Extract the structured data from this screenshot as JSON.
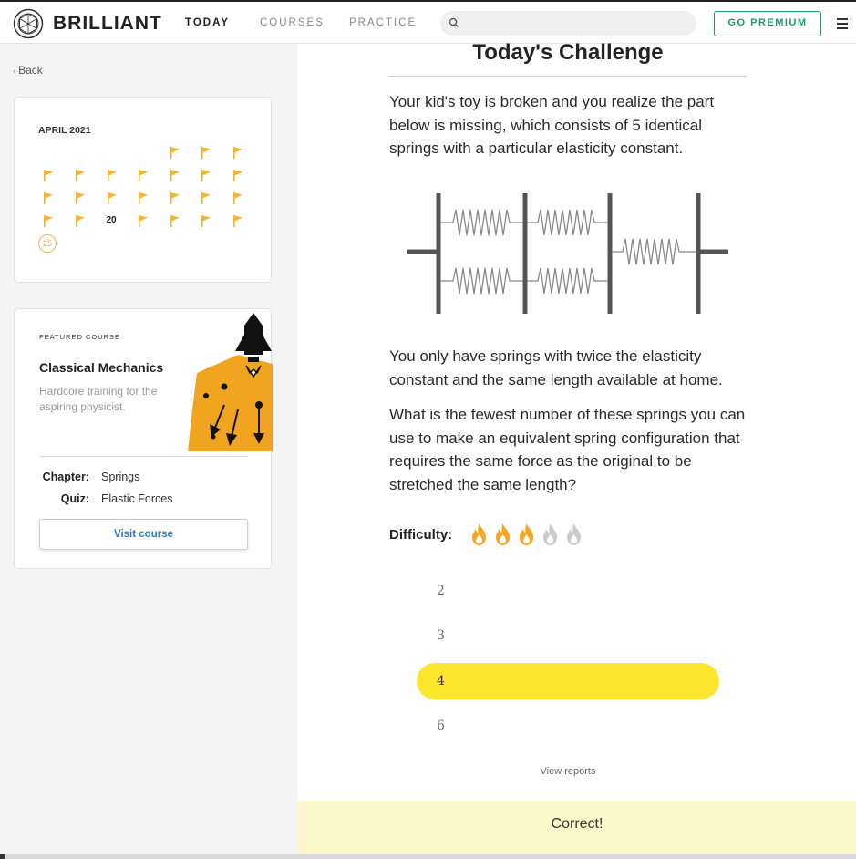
{
  "header": {
    "brand": "BRILLIANT",
    "nav": [
      {
        "label": "TODAY",
        "active": true
      },
      {
        "label": "COURSES",
        "active": false
      },
      {
        "label": "PRACTICE",
        "active": false
      }
    ],
    "search_placeholder": "",
    "premium_label": "GO PREMIUM"
  },
  "sidebar": {
    "back_label": "Back",
    "calendar": {
      "month": "APRIL 2021",
      "day_20": "20",
      "today": "25",
      "flag_color": "#f7b32b"
    },
    "featured": {
      "label": "FEATURED COURSE",
      "title": "Classical Mechanics",
      "description": "Hardcore training for the aspiring physicist.",
      "chapter_label": "Chapter:",
      "chapter_value": "Springs",
      "quiz_label": "Quiz:",
      "quiz_value": "Elastic Forces",
      "visit_label": "Visit course"
    }
  },
  "challenge": {
    "title": "Today's Challenge",
    "para1": "Your kid's toy is broken and you realize the part below is missing, which consists of 5 identical springs with a particular elasticity constant.",
    "para2": "You only have springs with twice the elasticity constant and the same length available at home.",
    "para3": "What is the fewest number of these springs you can use to make an equivalent spring configuration that requires the same force as the original to be stretched the same length?",
    "difficulty_label": "Difficulty:",
    "difficulty_level": 3,
    "difficulty_max": 5,
    "options": [
      {
        "value": "2",
        "selected": false
      },
      {
        "value": "3",
        "selected": false
      },
      {
        "value": "4",
        "selected": true
      },
      {
        "value": "6",
        "selected": false
      }
    ],
    "view_reports": "View reports",
    "result": "Correct!"
  },
  "colors": {
    "accent_green": "#1d9b6e",
    "flame_active": "#f5a623",
    "flame_inactive": "#cccccc",
    "selected_option": "#fee52e",
    "correct_bar": "#fdf8cc"
  }
}
